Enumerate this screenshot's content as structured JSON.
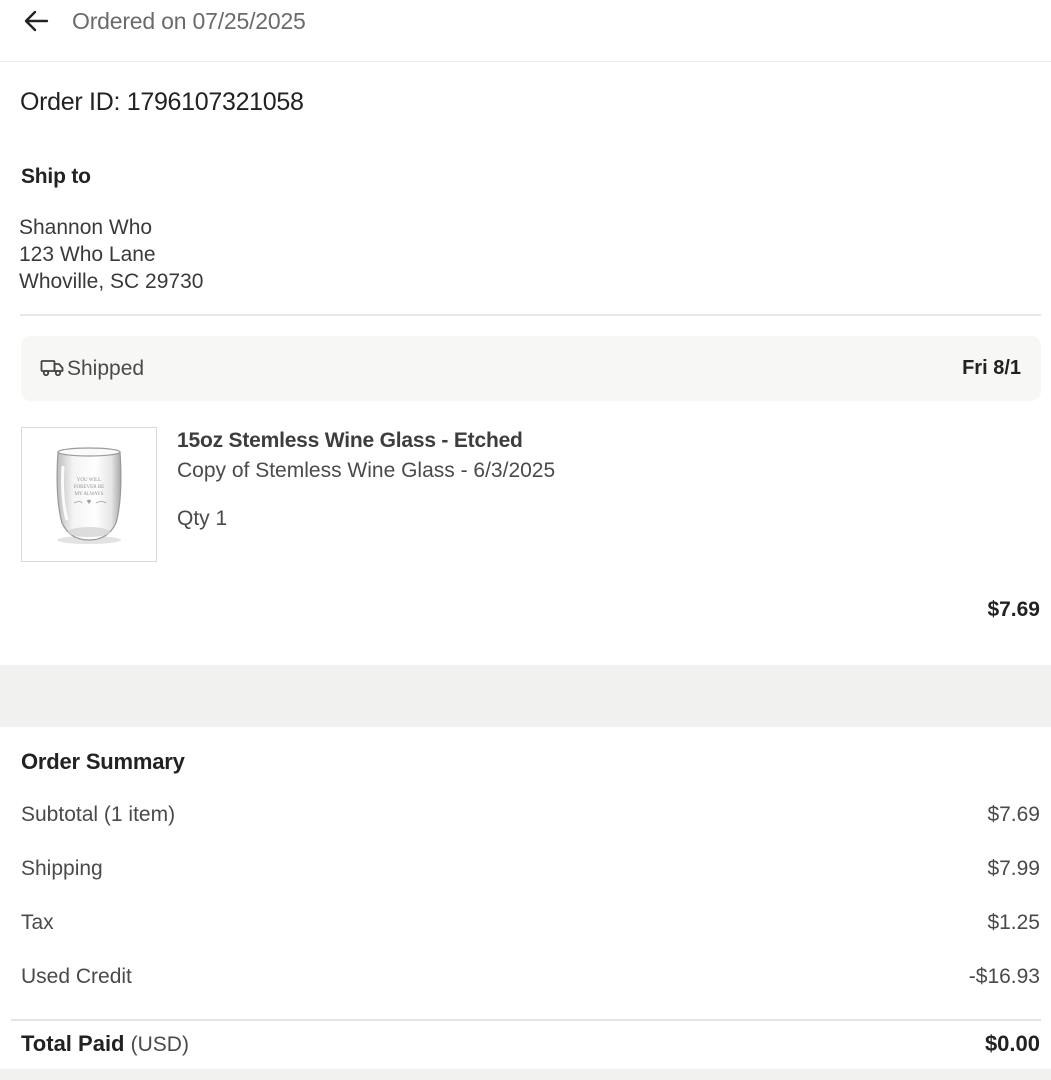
{
  "header": {
    "title": "Ordered on 07/25/2025",
    "back_icon": "arrow-left-icon"
  },
  "order": {
    "id_label": "Order ID: 1796107321058"
  },
  "shipping": {
    "heading": "Ship to",
    "address_lines": [
      "Shannon Who",
      "123 Who Lane",
      "Whoville, SC 29730"
    ]
  },
  "status": {
    "icon": "truck-icon",
    "label": "Shipped",
    "date": "Fri 8/1"
  },
  "product": {
    "image_icon": "wine-glass-image",
    "image_text": [
      "YOU WILL",
      "FOREVER BE",
      "MY ALWAYS"
    ],
    "name": "15oz Stemless Wine Glass - Etched",
    "variant": "Copy of Stemless Wine Glass - 6/3/2025",
    "qty": "Qty 1",
    "price": "$7.69"
  },
  "summary": {
    "heading": "Order Summary",
    "rows": [
      {
        "label": "Subtotal (1 item)",
        "value": "$7.69"
      },
      {
        "label": "Shipping",
        "value": "$7.99"
      },
      {
        "label": "Tax",
        "value": "$1.25"
      },
      {
        "label": "Used Credit",
        "value": "-$16.93"
      }
    ],
    "total_label": "Total Paid",
    "total_currency": "(USD)",
    "total_value": "$0.00"
  }
}
